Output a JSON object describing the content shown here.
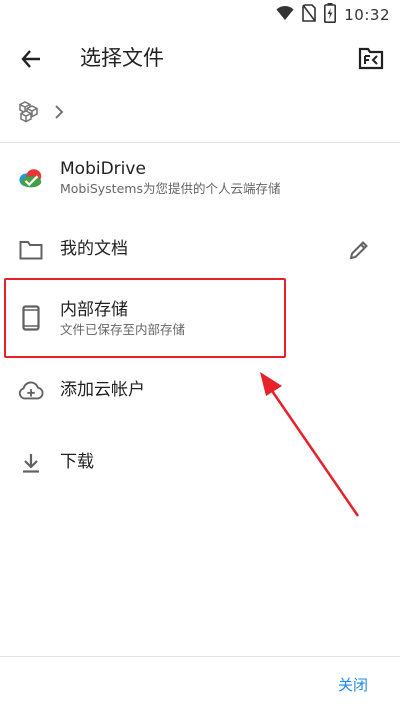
{
  "status_bar": {
    "time": "10:32",
    "icons": [
      "wifi-icon",
      "no-sim-icon",
      "battery-charging-icon"
    ]
  },
  "header": {
    "title": "选择文件",
    "back_icon": "arrow-left-icon",
    "action_icon": "fc-folder-icon"
  },
  "breadcrumb": {
    "icon": "root-cubes-icon",
    "separator": "chevron-right-icon"
  },
  "items": [
    {
      "primary": "MobiDrive",
      "secondary": "MobiSystems为您提供的个人云端存储",
      "icon": "mobidrive-cloud-icon"
    },
    {
      "primary": "我的文档",
      "icon": "folder-icon",
      "action_icon": "pencil-icon"
    },
    {
      "primary": "内部存储",
      "secondary": "文件已保存至内部存储",
      "icon": "phone-icon",
      "highlighted": true
    },
    {
      "primary": "添加云帐户",
      "icon": "cloud-add-icon"
    },
    {
      "primary": "下载",
      "icon": "download-icon"
    }
  ],
  "footer": {
    "close_label": "关闭"
  },
  "colors": {
    "highlight": "#e8202a",
    "accent": "#1e88e5",
    "icon": "#616161"
  }
}
